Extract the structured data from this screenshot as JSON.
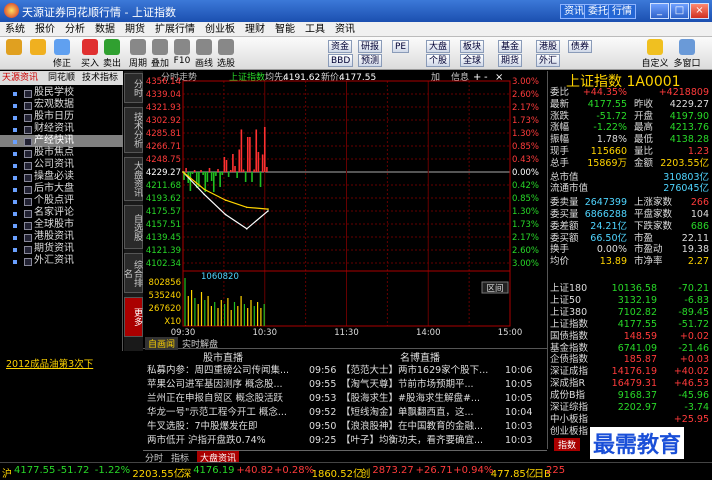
{
  "window": {
    "title": "天源证券同花顺行情 - 上证指数",
    "buttons": [
      "资讯",
      "委托",
      "行情"
    ]
  },
  "menu": [
    "系统",
    "报价",
    "分析",
    "数据",
    "期货",
    "扩展行情",
    "创业板",
    "理财",
    "智能",
    "工具",
    "资讯"
  ],
  "toolbar": {
    "tools": [
      {
        "label": "",
        "icon": "home-icon",
        "color": "#e0a020"
      },
      {
        "label": "",
        "icon": "back-arrow-icon",
        "color": "#f0b020"
      },
      {
        "label": "修正",
        "icon": "refresh-icon",
        "color": "#60a0f0"
      },
      {
        "label": "买入",
        "icon": "buy-icon",
        "color": "#e03030"
      },
      {
        "label": "卖出",
        "icon": "sell-icon",
        "color": "#30a030"
      },
      {
        "label": "周期",
        "icon": "cycle-icon",
        "color": "#888"
      },
      {
        "label": "叠加",
        "icon": "overlay-icon",
        "color": "#888"
      },
      {
        "label": "F10",
        "icon": "f10-icon",
        "color": "#888"
      },
      {
        "label": "画线",
        "icon": "draw-icon",
        "color": "#888"
      },
      {
        "label": "选股",
        "icon": "select-stock-icon",
        "color": "#888"
      }
    ],
    "small": [
      "资金",
      "研报",
      "PE",
      "大盘",
      "板块",
      "基金",
      "港股",
      "债券",
      "BBD",
      "预测",
      "个股",
      "全球",
      "期货",
      "外汇"
    ],
    "right": [
      "自定义",
      "多窗口"
    ]
  },
  "left_tabs": [
    "天源资讯",
    "同花顺",
    "技术指标"
  ],
  "left_tree": [
    "股民学校",
    "宏观数据",
    "股市日历",
    "财经资讯",
    "产经快讯",
    "股市焦点",
    "公司资讯",
    "操盘必读",
    "后市大盘",
    "个股点评",
    "名家评论",
    "全球股市",
    "港股资讯",
    "期货资讯",
    "外汇资讯"
  ],
  "left_news": "2012成品油第3次下",
  "vtabs": [
    "分时",
    "技术分析",
    "大盘资讯",
    "自选股",
    "综合排名",
    "更多"
  ],
  "chart": {
    "header": {
      "label": "分时走势",
      "name": "上证指数",
      "ma_label": "均先:",
      "price": "4191.62",
      "avg_label": "新价:",
      "avg": "4177.55"
    },
    "header_right": [
      "加",
      "信息"
    ],
    "left_ticks": [
      "4356.14",
      "4339.04",
      "4321.93",
      "4302.92",
      "4285.81",
      "4266.71",
      "4248.75",
      "4229.27",
      "4211.68",
      "4193.62",
      "4175.57",
      "4157.51",
      "4139.45",
      "4121.39",
      "4102.34"
    ],
    "right_ticks": [
      "3.00%",
      "2.60%",
      "2.17%",
      "1.73%",
      "1.30%",
      "0.85%",
      "0.43%",
      "0.00%",
      "0.42%",
      "0.85%",
      "1.30%",
      "1.73%",
      "2.17%",
      "2.60%",
      "3.00%"
    ],
    "vol_ticks": [
      "802856",
      "535240",
      "267620",
      "X10"
    ],
    "vol_label": "1060820",
    "time_ticks": [
      "09:30",
      "10:30",
      "11:30",
      "14:00",
      "15:00"
    ],
    "region_label": "区间"
  },
  "chart_data": {
    "type": "line",
    "title": "上证指数",
    "x": [
      "09:30",
      "09:45",
      "10:00",
      "10:15",
      "10:30"
    ],
    "series": [
      {
        "name": "上证指数",
        "values": [
          4229.27,
          4198.0,
          4170.0,
          4150.0,
          4175.0
        ]
      },
      {
        "name": "均价",
        "values": [
          4229.27,
          4205.0,
          4190.0,
          4180.0,
          4177.55
        ]
      }
    ],
    "ylim": [
      4102.34,
      4356.14
    ]
  },
  "news": {
    "tabs": [
      "自画闻",
      "实时解盘"
    ],
    "col1_title": "股市直播",
    "col2_title": "名博直播",
    "items_left": [
      {
        "t": "私募内参：周四重磅公司传闻集...",
        "time": "09:56"
      },
      {
        "t": "苹果公司进军基因测序 概念股...",
        "time": "09:55"
      },
      {
        "t": "兰州正在申报自贸区 概念股活跃",
        "time": "09:53"
      },
      {
        "t": "华龙一号\"示范工程今开工 概念...",
        "time": "09:52"
      },
      {
        "t": "牛叉选股：7中股爆发在即",
        "time": "09:50"
      },
      {
        "t": "两市低开 沪指开盘跌0.74%",
        "time": "09:25"
      }
    ],
    "items_right": [
      {
        "t": "【范范大士】两市1629家个股下...",
        "time": "10:06"
      },
      {
        "t": "【淘气天尊】节前市场预期平...",
        "time": "10:05"
      },
      {
        "t": "【股海求生】#股海求生解盘#...",
        "time": "10:05"
      },
      {
        "t": "【短线淘金】单飘翻西直，这...",
        "time": "10:04"
      },
      {
        "t": "【浪浪股神】在中国教育的金融...",
        "time": "10:03"
      },
      {
        "t": "【叶子】均衡功夫，看齐要确宜...",
        "time": "10:03"
      }
    ]
  },
  "bottom_tabs": [
    "分时",
    "指标",
    "大盘资讯"
  ],
  "quote": {
    "title": "上证指数 1A0001",
    "rows": [
      {
        "l": "委比",
        "v": "+44.35%",
        "l2": "",
        "v2": "+4218809",
        "c": "red",
        "c2": "red"
      },
      {
        "l": "最新",
        "v": "4177.55",
        "l2": "昨收",
        "v2": "4229.27",
        "c": "grn",
        "c2": "wht"
      },
      {
        "l": "涨跌",
        "v": "-51.72",
        "l2": "开盘",
        "v2": "4197.90",
        "c": "grn",
        "c2": "grn"
      },
      {
        "l": "涨幅",
        "v": "-1.22%",
        "l2": "最高",
        "v2": "4213.76",
        "c": "grn",
        "c2": "grn"
      },
      {
        "l": "振幅",
        "v": "1.78%",
        "l2": "最低",
        "v2": "4138.28",
        "c": "wht",
        "c2": "grn"
      },
      {
        "l": "现手",
        "v": "115660",
        "l2": "量比",
        "v2": "1.23",
        "c": "yel",
        "c2": "red"
      },
      {
        "l": "总手",
        "v": "15869万",
        "l2": "金额",
        "v2": "2203.55亿",
        "c": "yel",
        "c2": "yel"
      },
      {
        "l": "总市值",
        "v": "",
        "l2": "",
        "v2": "310803亿",
        "c": "yel",
        "c2": "cyn"
      },
      {
        "l": "流通市值",
        "v": "",
        "l2": "",
        "v2": "276045亿",
        "c": "yel",
        "c2": "cyn"
      },
      {
        "l": "委卖量",
        "v": "2647399",
        "l2": "上涨家数",
        "v2": "266",
        "c": "cyn",
        "c2": "red"
      },
      {
        "l": "委买量",
        "v": "6866288",
        "l2": "平盘家数",
        "v2": "104",
        "c": "cyn",
        "c2": "wht"
      },
      {
        "l": "委差额",
        "v": "24.21亿",
        "l2": "下跌家数",
        "v2": "686",
        "c": "cyn",
        "c2": "grn"
      },
      {
        "l": "委买额",
        "v": "66.50亿",
        "l2": "市盈",
        "v2": "22.11",
        "c": "cyn",
        "c2": "wht"
      },
      {
        "l": "换手",
        "v": "0.00%",
        "l2": "市盈动",
        "v2": "19.38",
        "c": "wht",
        "c2": "wht"
      },
      {
        "l": "均价",
        "v": "13.89",
        "l2": "市净率",
        "v2": "2.27",
        "c": "yel",
        "c2": "yel"
      }
    ],
    "indices": [
      {
        "n": "上证180",
        "v": "10136.58",
        "d": "-70.21"
      },
      {
        "n": "上证50",
        "v": "3132.19",
        "d": "-6.83"
      },
      {
        "n": "上证380",
        "v": "7102.82",
        "d": "-89.45"
      },
      {
        "n": "上证指数",
        "v": "4177.55",
        "d": "-51.72"
      },
      {
        "n": "国债指数",
        "v": "148.59",
        "d": "+0.02"
      },
      {
        "n": "基金指数",
        "v": "6741.09",
        "d": "-21.46"
      },
      {
        "n": "企债指数",
        "v": "185.87",
        "d": "+0.03"
      },
      {
        "n": "深证成指",
        "v": "14176.19",
        "d": "+40.02"
      },
      {
        "n": "深成指R",
        "v": "16479.31",
        "d": "+46.53"
      },
      {
        "n": "成份B指",
        "v": "9168.37",
        "d": "-45.96"
      },
      {
        "n": "深证综指",
        "v": "2202.97",
        "d": "-3.74"
      },
      {
        "n": "中小板指",
        "v": "",
        "d": "+25.95"
      },
      {
        "n": "创业板指",
        "v": "",
        "d": ""
      }
    ],
    "bottom_label": "指数"
  },
  "status": [
    {
      "t": "沪",
      "c": "#ffd400"
    },
    {
      "t": "4177.55",
      "c": "#28d828"
    },
    {
      "t": "-51.72",
      "c": "#28d828"
    },
    {
      "t": "-1.22%",
      "c": "#28d828"
    },
    {
      "t": "2203.55亿",
      "c": "#ffd400"
    },
    {
      "t": "深",
      "c": "#ffd400"
    },
    {
      "t": "4176.19",
      "c": "#28d828"
    },
    {
      "t": "+40.82",
      "c": "#ff3b3b"
    },
    {
      "t": "+0.28%",
      "c": "#ff3b3b"
    },
    {
      "t": "1860.52亿",
      "c": "#ffd400"
    },
    {
      "t": "创",
      "c": "#ffd400"
    },
    {
      "t": "2873.27",
      "c": "#ff3b3b"
    },
    {
      "t": "+26.71",
      "c": "#ff3b3b"
    },
    {
      "t": "+0.94%",
      "c": "#ff3b3b"
    },
    {
      "t": "477.85亿",
      "c": "#ffd400"
    },
    {
      "t": "日B",
      "c": "#ffd400"
    },
    {
      "t": "225",
      "c": "#ff3b3b"
    }
  ],
  "watermark": "最需教育"
}
